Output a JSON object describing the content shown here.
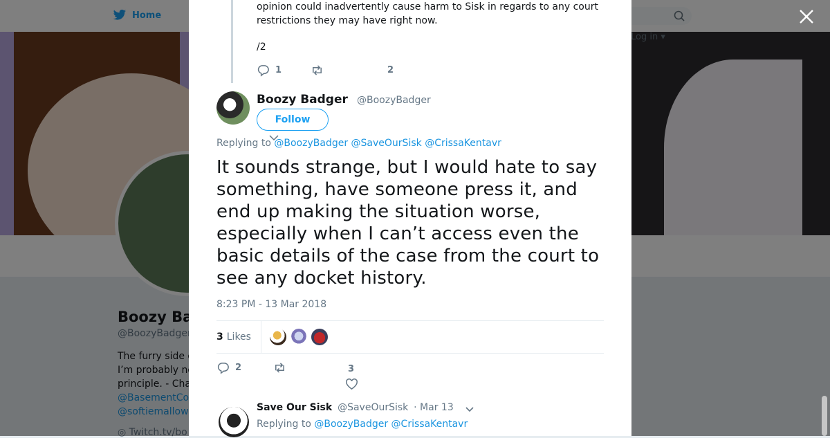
{
  "background": {
    "nav": {
      "home_label": "Home",
      "login_label": "Log in ▾"
    },
    "profile": {
      "name": "Boozy Ba",
      "handle": "@BoozyBadger",
      "bio_lines": [
        "The furry side o",
        "I’m probably no",
        "principle. - Cha"
      ],
      "bio_links": [
        "@BasementCo",
        "@softiemallow"
      ],
      "website": "Twitch.tv/bo"
    }
  },
  "previous_tweet": {
    "text": "opinion could inadvertently cause harm to Sisk in regards to any court restrictions they may have right now.",
    "signature": "/2",
    "reply_count": "1",
    "like_count": "2"
  },
  "tweet": {
    "author_name": "Boozy Badger",
    "author_handle": "@BoozyBadger",
    "follow_label": "Follow",
    "replying_label": "Replying to",
    "replying_to": [
      "@BoozyBadger",
      "@SaveOurSisk",
      "@CrissaKentavr"
    ],
    "text": "It sounds strange, but I would hate to say something, have someone press it, and end up making the situation worse, especially when I can’t access even the basic details of the case from the court to see any docket history.",
    "timestamp": "8:23 PM - 13 Mar 2018",
    "likes_count": "3",
    "likes_label": "Likes",
    "reply_count": "2",
    "like_count": "3"
  },
  "next_tweet": {
    "author_name": "Save Our Sisk",
    "author_handle": "@SaveOurSisk",
    "date": "· Mar 13",
    "replying_label": "Replying to",
    "replying_to": [
      "@BoozyBadger",
      "@CrissaKentavr"
    ]
  },
  "colors": {
    "accent": "#1da1f2",
    "link": "#1b95e0",
    "muted": "#657786"
  }
}
